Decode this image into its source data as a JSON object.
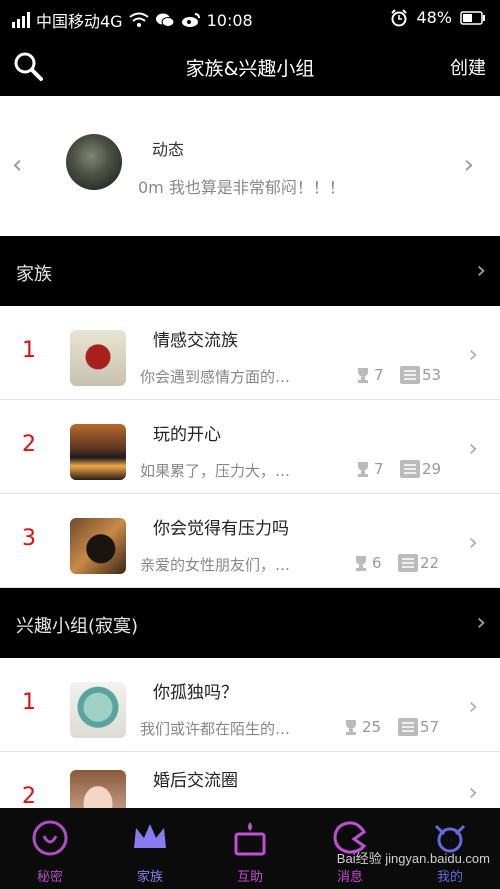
{
  "status_bar": {
    "carrier": "中国移动4G",
    "time": "10:08",
    "battery": "48%"
  },
  "header": {
    "title": "家族&兴趣小组",
    "create_label": "创建"
  },
  "feed": {
    "label": "动态",
    "text": "0m 我也算是非常郁闷！！！"
  },
  "families": {
    "title": "家族",
    "items": [
      {
        "rank": "1",
        "name": "情感交流族",
        "desc": "你会遇到感情方面的…",
        "members": "7",
        "posts": "53"
      },
      {
        "rank": "2",
        "name": "玩的开心",
        "desc": "如果累了，压力大，…",
        "members": "7",
        "posts": "29"
      },
      {
        "rank": "3",
        "name": "你会觉得有压力吗",
        "desc": "亲爱的女性朋友们，…",
        "members": "6",
        "posts": "22"
      }
    ]
  },
  "groups": {
    "title": "兴趣小组(寂寞)",
    "items": [
      {
        "rank": "1",
        "name": "你孤独吗？",
        "desc": "我们或许都在陌生的…",
        "members": "25",
        "posts": "57"
      },
      {
        "rank": "2",
        "name": "婚后交流圈"
      }
    ]
  },
  "tabs": [
    {
      "label": "秘密",
      "color": "#b04cc4"
    },
    {
      "label": "家族",
      "color": "#8a7cf0"
    },
    {
      "label": "互助",
      "color": "#c04fd6"
    },
    {
      "label": "消息",
      "color": "#c04fd6"
    },
    {
      "label": "我的",
      "color": "#5f6cd9"
    }
  ],
  "watermark": "Bai经验 jingyan.baidu.com",
  "colors": {
    "rank": "#e01010",
    "accent": "#8a7cf0"
  }
}
